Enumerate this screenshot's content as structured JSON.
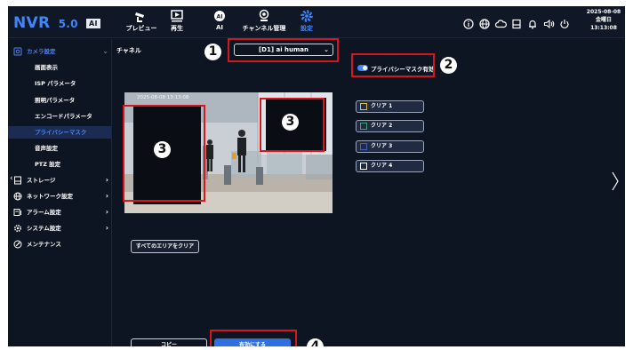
{
  "app": {
    "name": "NVR",
    "version": "5.0",
    "badge": "AI"
  },
  "nav_tabs": [
    {
      "id": "preview",
      "label": "プレビュー",
      "icon": "cctv-camera-icon",
      "active": false
    },
    {
      "id": "playback",
      "label": "再生",
      "icon": "playback-icon",
      "active": false
    },
    {
      "id": "ai",
      "label": "AI",
      "icon": "ai-icon",
      "active": false
    },
    {
      "id": "channel",
      "label": "チャンネル管理",
      "icon": "camera-settings-icon",
      "active": false
    },
    {
      "id": "settings",
      "label": "設定",
      "icon": "gear-icon",
      "active": true
    }
  ],
  "header_icons": [
    "info-icon",
    "network-icon",
    "cloud-icon",
    "storage-icon",
    "bell-icon",
    "volume-icon",
    "power-icon"
  ],
  "datetime": {
    "date": "2025-08-08",
    "weekday": "金曜日",
    "time": "13:13:08"
  },
  "sidebar": {
    "camera_settings": {
      "label": "カメラ設定",
      "icon": "camera-settings-icon",
      "children": [
        "画面表示",
        "ISP パラメータ",
        "照明パラメータ",
        "エンコードパラメータ",
        "プライバシーマスク",
        "音声設定",
        "PTZ 設定"
      ],
      "active_child": "プライバシーマスク"
    },
    "groups": [
      {
        "label": "ストレージ",
        "icon": "storage-icon"
      },
      {
        "label": "ネットワーク設定",
        "icon": "globe-icon"
      },
      {
        "label": "アラーム設定",
        "icon": "alarm-icon"
      },
      {
        "label": "システム設定",
        "icon": "gear-icon"
      },
      {
        "label": "メンテナンス",
        "icon": "maintenance-icon"
      }
    ]
  },
  "content": {
    "channel_label": "チャネル",
    "channel_select": "[D1] ai human",
    "mask_toggle_label": "プライバシーマスク有効",
    "mask_enabled": true,
    "video_timestamp": "2025-08-08 13:13:08",
    "areas": [
      {
        "label": "クリア 1",
        "color": "#e0c040"
      },
      {
        "label": "クリア 2",
        "color": "#40a070"
      },
      {
        "label": "クリア 3",
        "color": "#4060c0"
      },
      {
        "label": "クリア 4",
        "color": "#ffffff"
      }
    ],
    "clear_all_label": "すべてのエリアをクリア",
    "copy_label": "コピー",
    "apply_label": "有効にする"
  },
  "annotations": {
    "badge_1": "1",
    "badge_2": "2",
    "badge_3a": "3",
    "badge_3b": "3",
    "badge_4": "4"
  },
  "colors": {
    "accent": "#3f86ff",
    "highlight": "#d4161d",
    "background": "#0d1422"
  }
}
